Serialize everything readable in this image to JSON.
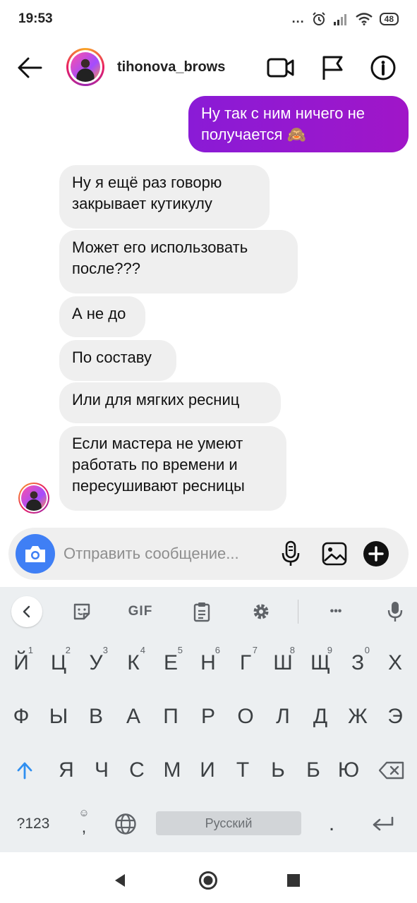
{
  "status": {
    "time": "19:53",
    "battery": "48",
    "dots": "..."
  },
  "header": {
    "username": "tihonova_brows",
    "icons": [
      "back-arrow-icon",
      "video-call-icon",
      "flag-icon",
      "info-icon"
    ]
  },
  "messages": [
    {
      "direction": "outgoing",
      "lines": [
        "Ну так с ним ничего не",
        "получается 🙈"
      ]
    },
    {
      "direction": "incoming",
      "lines": [
        "Ну я ещё раз говорю",
        "закрывает кутикулу"
      ]
    },
    {
      "direction": "incoming",
      "lines": [
        "Может его использовать",
        "после???"
      ]
    },
    {
      "direction": "incoming",
      "lines": [
        "А не до"
      ]
    },
    {
      "direction": "incoming",
      "lines": [
        "По составу"
      ]
    },
    {
      "direction": "incoming",
      "lines": [
        "Или для мягких ресниц"
      ]
    },
    {
      "direction": "incoming",
      "lines": [
        "Если мастера не умеют",
        "работать по времени и",
        "пересушивают ресницы"
      ]
    }
  ],
  "composer": {
    "placeholder": "Отправить сообщение...",
    "icons": [
      "camera-icon",
      "microphone-icon",
      "gallery-icon",
      "add-icon"
    ]
  },
  "keyboard": {
    "toolbar": {
      "gif": "GIF",
      "more": "•••",
      "icons": [
        "chevron-left-icon",
        "sticker-icon",
        "clipboard-icon",
        "settings-icon",
        "microphone-icon"
      ]
    },
    "row1": [
      {
        "char": "Й",
        "hint": "1"
      },
      {
        "char": "Ц",
        "hint": "2"
      },
      {
        "char": "У",
        "hint": "3"
      },
      {
        "char": "К",
        "hint": "4"
      },
      {
        "char": "Е",
        "hint": "5"
      },
      {
        "char": "Н",
        "hint": "6"
      },
      {
        "char": "Г",
        "hint": "7"
      },
      {
        "char": "Ш",
        "hint": "8"
      },
      {
        "char": "Щ",
        "hint": "9"
      },
      {
        "char": "З",
        "hint": "0"
      },
      {
        "char": "Х",
        "hint": ""
      }
    ],
    "row2": [
      "Ф",
      "Ы",
      "В",
      "А",
      "П",
      "Р",
      "О",
      "Л",
      "Д",
      "Ж",
      "Э"
    ],
    "row3": [
      "Я",
      "Ч",
      "С",
      "М",
      "И",
      "Т",
      "Ь",
      "Б",
      "Ю"
    ],
    "row4": {
      "numbers": "?123",
      "comma": ",",
      "space": "Русский",
      "period": "."
    }
  },
  "navbar": {
    "icons": [
      "back-triangle-icon",
      "home-circle-icon",
      "recents-square-icon"
    ]
  }
}
